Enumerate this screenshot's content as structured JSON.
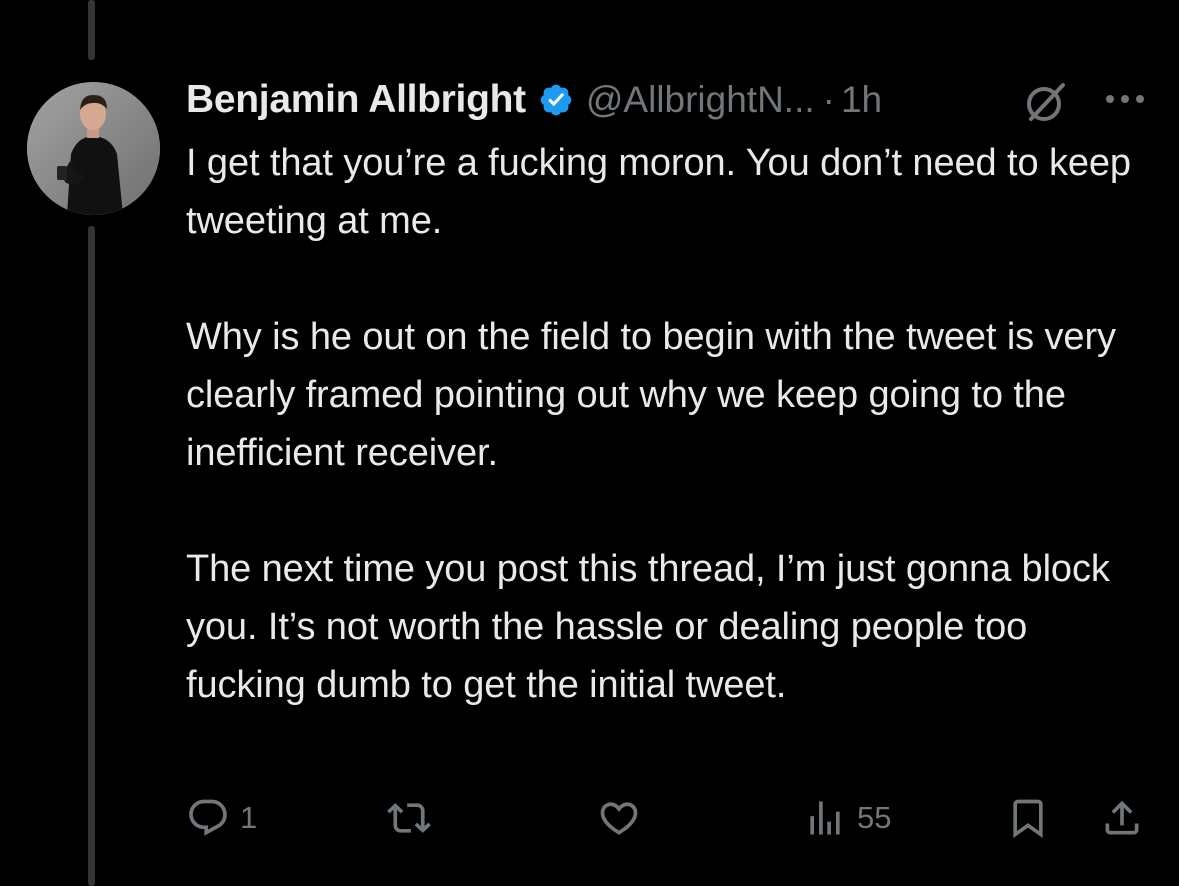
{
  "tweet": {
    "author_name": "Benjamin Allbright",
    "handle": "@AllbrightN...",
    "separator": "·",
    "timestamp": "1h",
    "paragraphs": [
      "I get that you’re a fucking moron. You don’t need to keep tweeting at me.",
      "Why is he out on the field to begin with the tweet is very clearly framed pointing out why we keep going to the inefficient receiver.",
      "The next time you post this thread, I’m just gonna block you. It’s not worth the hassle or dealing people too fucking dumb to get the initial tweet."
    ]
  },
  "actions": {
    "reply_count": "1",
    "retweet_count": "",
    "like_count": "",
    "views_count": "55"
  },
  "icons": {
    "verified": "verified-badge-icon",
    "grok": "grok-icon",
    "more": "more-icon",
    "reply": "reply-icon",
    "retweet": "retweet-icon",
    "like": "heart-icon",
    "views": "views-icon",
    "bookmark": "bookmark-icon",
    "share": "share-icon"
  },
  "colors": {
    "background": "#000000",
    "text_primary": "#e7e9ea",
    "text_secondary": "#71767b",
    "verified_blue": "#1d9bf0",
    "thread_line": "#333639"
  }
}
